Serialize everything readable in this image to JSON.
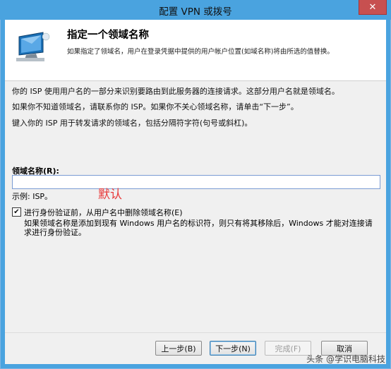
{
  "window": {
    "title": "配置 VPN 或拨号",
    "close_glyph": "✕"
  },
  "header": {
    "title": "指定一个领域名称",
    "description": "如果指定了领域名，用户在登录凭据中提供的用户帐户位置(如域名称)将由所选的值替换。"
  },
  "body": {
    "para1": "你的 ISP 使用用户名的一部分来识别要路由到此服务器的连接请求。这部分用户名就是领域名。",
    "para2": "如果你不知道领域名，请联系你的 ISP。如果你不关心领域名称，请单击“下一步”。",
    "para3": "键入你的 ISP 用于转发请求的领域名，包括分隔符字符(句号或斜杠)。",
    "field_label": "领域名称(R):",
    "field_value": "",
    "example": "示例: ISP。",
    "annotation": "默认",
    "checkbox_checked": true,
    "checkbox_glyph": "✔",
    "checkbox_label": "进行身份验证前，从用户名中删除领域名称(E)",
    "checkbox_desc": "如果领域名称是添加到现有 Windows 用户名的标识符，则只有将其移除后，Windows 才能对连接请求进行身份验证。"
  },
  "footer": {
    "back": "上一步(B)",
    "next": "下一步(N)",
    "finish": "完成(F)",
    "cancel": "取消"
  },
  "watermark": {
    "text": "头条 @学识电脑科技"
  },
  "colors": {
    "titlebar": "#4aa3df",
    "close": "#c75050",
    "annotation": "#e83a3a"
  }
}
